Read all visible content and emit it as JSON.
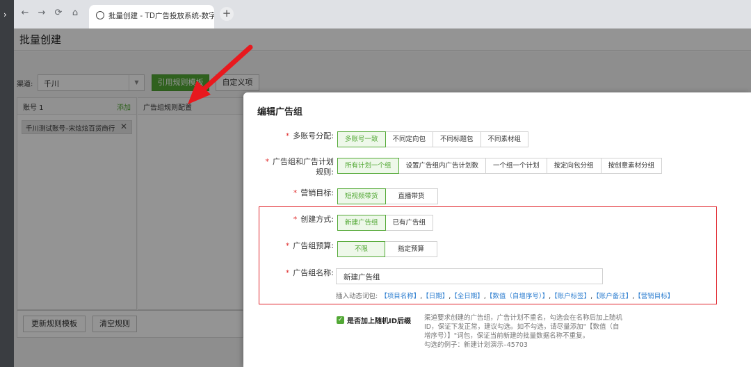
{
  "browser": {
    "side_glyph": "›",
    "back": "←",
    "forward": "→",
    "reload": "⟳",
    "home": "⌂",
    "tab_title": "批量创建 - TD广告投放系统-数字化",
    "new_tab": "+"
  },
  "page": {
    "title": "批量创建",
    "channel_label": "渠道:",
    "channel_value": "千川",
    "use_rule_template": "引用规则模板",
    "custom_item": "自定义项",
    "account_header": "账号 1",
    "add_label": "添加",
    "account_item": "千川测试账号–宋炫炫百货商行",
    "remove_glyph": "✕",
    "rule_header": "广告组规则配置",
    "update_rule_template": "更新规则模板",
    "clear_rules": "清空规则"
  },
  "drawer": {
    "title": "编辑广告组",
    "required_mark": "*",
    "fields": {
      "multi_account": {
        "label": "多账号分配:",
        "options": [
          "多账号一致",
          "不同定向包",
          "不同标题包",
          "不同素材组"
        ],
        "selected": 0
      },
      "group_rule": {
        "label_line1": "广告组和广告计划",
        "label_line2": "规则:",
        "options": [
          "所有计划一个组",
          "设置广告组内广告计划数",
          "一个组一个计划",
          "按定向包分组",
          "按创意素材分组"
        ],
        "selected": 0
      },
      "marketing_goal": {
        "label": "营销目标:",
        "options": [
          "短视频带货",
          "直播带货"
        ],
        "selected": 0
      },
      "create_method": {
        "label": "创建方式:",
        "options": [
          "新建广告组",
          "已有广告组"
        ],
        "selected": 0
      },
      "budget": {
        "label": "广告组预算:",
        "options": [
          "不限",
          "指定预算"
        ],
        "selected": 0
      },
      "group_name": {
        "label": "广告组名称:",
        "value": "新建广告组",
        "dynamic_label": "插入动态词包:",
        "dynamic_tags": [
          "【项目名称】",
          "【日期】",
          "【全日期】",
          "【数值（自增序号）】",
          "【账户标签】",
          "【账户备注】",
          "【营销目标】"
        ]
      }
    },
    "random_id": {
      "checked": true,
      "check_glyph": "✓",
      "label": "是否加上随机ID后缀",
      "help_line1": "渠道要求创建的广告组，广告计划不重名，勾选会在名称后加上随机",
      "help_line2": "ID，保证下发正常，建议勾选。如不勾选，请尽量添加\"【数值（自",
      "help_line3": "增序号）】\"词包，保证当前新建的批量数据名称不重复。",
      "example": "勾选的例子：新建计划演示–45703"
    }
  },
  "colors": {
    "accent_green": "#52a835",
    "highlight_red": "#e0222a",
    "link_blue": "#2f7fd0",
    "arrow_red": "#e8191e"
  }
}
